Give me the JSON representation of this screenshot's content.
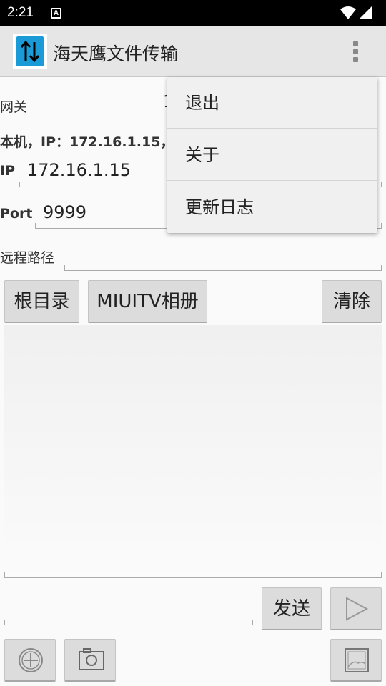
{
  "status_bar": {
    "time": "2:21",
    "notification_letter": "A"
  },
  "app_bar": {
    "title": "海天鹰文件传输",
    "overflow_icon": "more-vert-icon"
  },
  "form": {
    "gateway_label": "网关",
    "gateway_value_partial": "1",
    "local_ip_text": "本机，IP：172.16.1.15，",
    "ip_label": "IP",
    "ip_value": "172.16.1.15",
    "port_label": "Port",
    "port_value": "9999",
    "remote_path_label": "远程路径",
    "remote_path_value": ""
  },
  "buttons": {
    "root_dir": "根目录",
    "miuitv_album": "MIUITV相册",
    "clear": "清除",
    "send": "发送"
  },
  "bottom_icons": [
    "add-circle-icon",
    "camera-icon",
    "image-icon"
  ],
  "overflow_menu": {
    "items": [
      {
        "label": "退出"
      },
      {
        "label": "关于"
      },
      {
        "label": "更新日志"
      }
    ]
  },
  "message_input": {
    "value": ""
  }
}
